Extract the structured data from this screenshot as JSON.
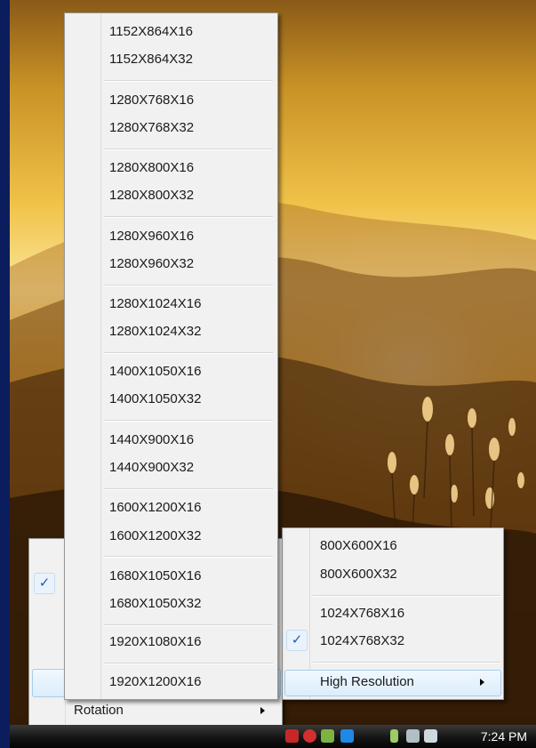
{
  "main_menu": {
    "items": [
      {
        "label": "Rotation"
      }
    ]
  },
  "resolution_submenu": {
    "items": [
      {
        "label": "800X600X16"
      },
      {
        "label": "800X600X32"
      },
      {
        "label": "1024X768X16"
      },
      {
        "label": "1024X768X32",
        "checked": true
      },
      {
        "label": "High Resolution",
        "has_submenu": true
      }
    ]
  },
  "high_resolution_submenu": {
    "items": [
      {
        "label": "1152X864X16"
      },
      {
        "label": "1152X864X32"
      },
      {
        "label": "1280X768X16"
      },
      {
        "label": "1280X768X32"
      },
      {
        "label": "1280X800X16"
      },
      {
        "label": "1280X800X32"
      },
      {
        "label": "1280X960X16"
      },
      {
        "label": "1280X960X32"
      },
      {
        "label": "1280X1024X16"
      },
      {
        "label": "1280X1024X32"
      },
      {
        "label": "1400X1050X16"
      },
      {
        "label": "1400X1050X32"
      },
      {
        "label": "1440X900X16"
      },
      {
        "label": "1440X900X32"
      },
      {
        "label": "1600X1200X16"
      },
      {
        "label": "1600X1200X32"
      },
      {
        "label": "1680X1050X16"
      },
      {
        "label": "1680X1050X32"
      },
      {
        "label": "1920X1080X16"
      },
      {
        "label": "1920X1200X16"
      }
    ]
  },
  "taskbar": {
    "clock": "7:24 PM",
    "tray_icons": [
      "graphics-driver-icon",
      "security-alert-icon",
      "safely-remove-hardware-icon",
      "intel-graphics-tray-icon",
      "battery-icon",
      "network-disconnected-icon",
      "volume-icon"
    ]
  },
  "colors": {
    "checkmark": "#1f5fb0",
    "highlight": "#dbedfb",
    "menu_bg": "#f1f1f1"
  }
}
